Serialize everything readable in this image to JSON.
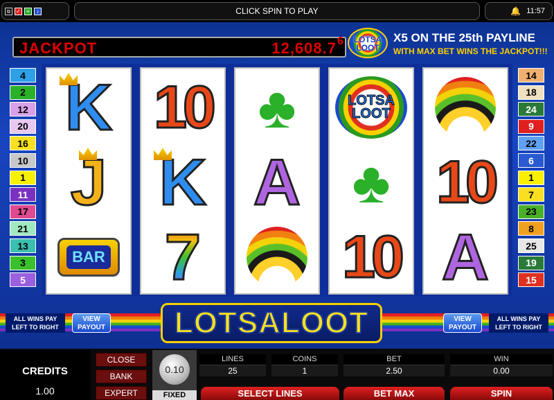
{
  "topbar": {
    "message": "CLICK SPIN TO PLAY",
    "time": "11:57",
    "icons": [
      "window-icon",
      "checkbox-icon",
      "options-icon",
      "sound-icon",
      "bell-icon"
    ]
  },
  "jackpot": {
    "label": "JACKPOT",
    "value": "12,608.7",
    "trailing_digit": "6",
    "badge": "LOTSA LOOT",
    "promo_line1": "X5 ON THE 25th PAYLINE",
    "promo_line2": "WITH MAX BET WINS THE JACKPOT!!!"
  },
  "reels": [
    [
      "K",
      "J",
      "BAR"
    ],
    [
      "10",
      "K",
      "7"
    ],
    [
      "clover",
      "A",
      "pot"
    ],
    [
      "LOTSA LOOT",
      "clover",
      "10"
    ],
    [
      "pot",
      "10",
      "A"
    ]
  ],
  "paylines_left": [
    {
      "n": "4",
      "color": "#2ea0e8"
    },
    {
      "n": "2",
      "color": "#2bb02a"
    },
    {
      "n": "12",
      "color": "#d8a0e8"
    },
    {
      "n": "20",
      "color": "#e8c8f0"
    },
    {
      "n": "16",
      "color": "#f8e020"
    },
    {
      "n": "10",
      "color": "#c8c8c8"
    },
    {
      "n": "1",
      "color": "#f8f000"
    },
    {
      "n": "11",
      "color": "#7a30c0"
    },
    {
      "n": "17",
      "color": "#e04a90"
    },
    {
      "n": "21",
      "color": "#a0e8c0"
    },
    {
      "n": "13",
      "color": "#3ac0b0"
    },
    {
      "n": "3",
      "color": "#3ac02a"
    },
    {
      "n": "5",
      "color": "#9a60e0"
    }
  ],
  "paylines_right": [
    {
      "n": "14",
      "color": "#f0b070"
    },
    {
      "n": "18",
      "color": "#f0e0c0"
    },
    {
      "n": "24",
      "color": "#2a7a3a"
    },
    {
      "n": "9",
      "color": "#e02020"
    },
    {
      "n": "22",
      "color": "#60a0f0"
    },
    {
      "n": "6",
      "color": "#2a5ad0"
    },
    {
      "n": "1",
      "color": "#f8f000"
    },
    {
      "n": "7",
      "color": "#f8e020"
    },
    {
      "n": "23",
      "color": "#4ab02a"
    },
    {
      "n": "8",
      "color": "#f0a020"
    },
    {
      "n": "25",
      "color": "#e8e8e8"
    },
    {
      "n": "19",
      "color": "#2a7a3a"
    },
    {
      "n": "15",
      "color": "#e03020"
    }
  ],
  "strip": {
    "wins_pay": "ALL WINS PAY LEFT TO RIGHT",
    "view_payout": "VIEW PAYOUT",
    "logo": "LOTSALOOT"
  },
  "panel": {
    "credits_label": "CREDITS",
    "credits_value": "1.00",
    "close": "CLOSE",
    "bank": "BANK",
    "expert": "EXPERT",
    "coin_value": "0.10",
    "fixed": "FIXED",
    "lines_label": "LINES",
    "lines_value": "25",
    "coins_label": "COINS",
    "coins_value": "1",
    "bet_label": "BET",
    "bet_value": "2.50",
    "win_label": "WIN",
    "win_value": "0.00",
    "select_lines": "SELECT LINES",
    "bet_max": "BET MAX",
    "spin": "SPIN"
  }
}
